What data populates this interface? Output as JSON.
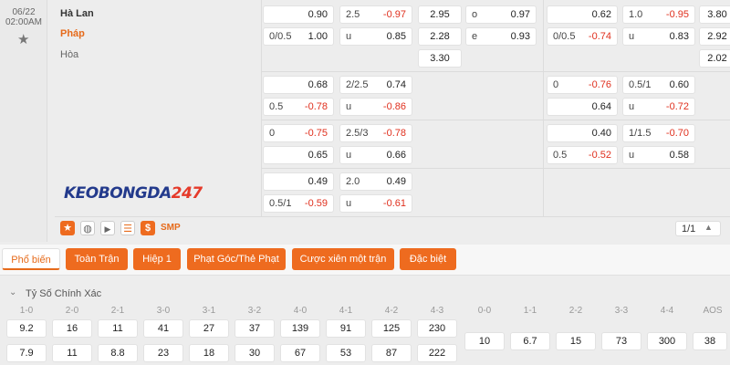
{
  "match": {
    "date": "06/22",
    "time": "02:00AM",
    "home": "Hà Lan",
    "away": "Pháp",
    "draw": "Hòa",
    "logo_part1": "KEOBONGDA",
    "logo_part2": "247"
  },
  "ft": {
    "row1": {
      "hdp_home": {
        "label": "",
        "value": "0.90"
      },
      "hdp_away": {
        "label": "0/0.5",
        "value": "1.00"
      },
      "ou_over": {
        "label": "2.5",
        "value": "-0.97"
      },
      "ou_under": {
        "label": "u",
        "value": "0.85"
      },
      "x12_home": "2.95",
      "x12_away": "2.28",
      "x12_draw": "3.30",
      "oe_odd": {
        "label": "o",
        "value": "0.97"
      },
      "oe_even": {
        "label": "e",
        "value": "0.93"
      }
    },
    "row2": {
      "hdp_home": {
        "label": "",
        "value": "0.68"
      },
      "hdp_away": {
        "label": "0.5",
        "value": "-0.78"
      },
      "ou_over": {
        "label": "2/2.5",
        "value": "0.74"
      },
      "ou_under": {
        "label": "u",
        "value": "-0.86"
      }
    },
    "row3": {
      "hdp_home": {
        "label": "0",
        "value": "-0.75"
      },
      "hdp_away": {
        "label": "",
        "value": "0.65"
      },
      "ou_over": {
        "label": "2.5/3",
        "value": "-0.78"
      },
      "ou_under": {
        "label": "u",
        "value": "0.66"
      }
    },
    "row4": {
      "hdp_home": {
        "label": "",
        "value": "0.49"
      },
      "hdp_away": {
        "label": "0.5/1",
        "value": "-0.59"
      },
      "ou_over": {
        "label": "2.0",
        "value": "0.49"
      },
      "ou_under": {
        "label": "u",
        "value": "-0.61"
      }
    }
  },
  "h1": {
    "row1": {
      "hdp_home": {
        "label": "",
        "value": "0.62"
      },
      "hdp_away": {
        "label": "0/0.5",
        "value": "-0.74"
      },
      "ou_over": {
        "label": "1.0",
        "value": "-0.95"
      },
      "ou_under": {
        "label": "u",
        "value": "0.83"
      },
      "x12_home": "3.80",
      "x12_away": "2.92",
      "x12_draw": "2.02"
    },
    "row2": {
      "hdp_home": {
        "label": "0",
        "value": "-0.76"
      },
      "hdp_away": {
        "label": "",
        "value": "0.64"
      },
      "ou_over": {
        "label": "0.5/1",
        "value": "0.60"
      },
      "ou_under": {
        "label": "u",
        "value": "-0.72"
      }
    },
    "row3": {
      "hdp_home": {
        "label": "",
        "value": "0.40"
      },
      "hdp_away": {
        "label": "0.5",
        "value": "-0.52"
      },
      "ou_over": {
        "label": "1/1.5",
        "value": "-0.70"
      },
      "ou_under": {
        "label": "u",
        "value": "0.58"
      }
    }
  },
  "toolbar": {
    "smp_label": "SMP",
    "page_text": "1/1",
    "icons": [
      "star-icon",
      "pig-icon",
      "play-icon",
      "stats-icon",
      "dollar-icon"
    ]
  },
  "tabs": [
    "Phổ biến",
    "Toàn Trận",
    "Hiệp 1",
    "Phạt Góc/Thẻ Phạt",
    "Cược xiên một trận",
    "Đặc biệt"
  ],
  "correct_score": {
    "title": "Tỷ Số Chính Xác",
    "labels": [
      "1-0",
      "2-0",
      "2-1",
      "3-0",
      "3-1",
      "3-2",
      "4-0",
      "4-1",
      "4-2",
      "4-3",
      "0-0",
      "1-1",
      "2-2",
      "3-3",
      "4-4",
      "AOS"
    ],
    "home_row": [
      "9.2",
      "16",
      "11",
      "41",
      "27",
      "37",
      "139",
      "91",
      "125",
      "230"
    ],
    "away_row": [
      "7.9",
      "11",
      "8.8",
      "23",
      "18",
      "30",
      "67",
      "53",
      "87",
      "222"
    ],
    "draw_row": [
      "10",
      "6.7",
      "15",
      "73",
      "300",
      "38"
    ]
  },
  "colors": {
    "accent": "#ee6b1f",
    "negative": "#e0301e",
    "logo_blue": "#233a8c"
  }
}
